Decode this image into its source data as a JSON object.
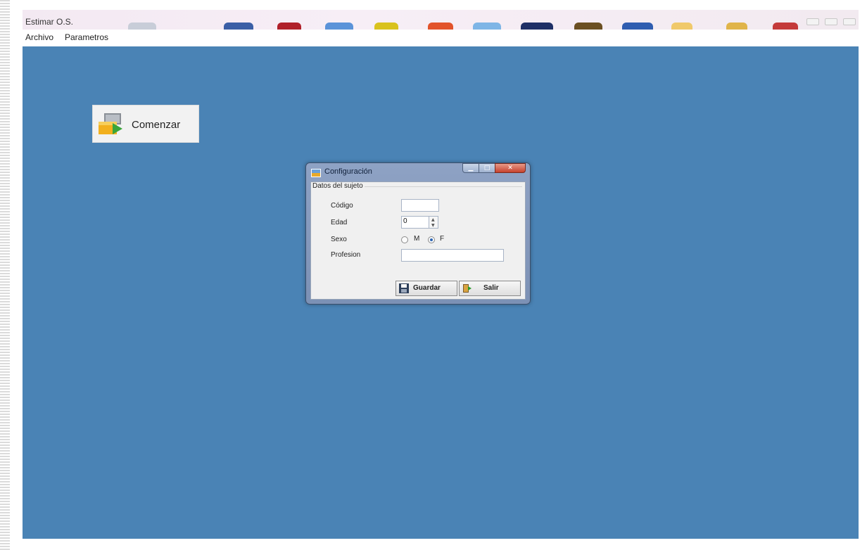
{
  "window": {
    "title": "Estimar O.S."
  },
  "menu": [
    {
      "label": "Archivo"
    },
    {
      "label": "Parametros"
    }
  ],
  "workspace": {
    "background": "#4a83b5"
  },
  "start_button": {
    "label": "Comenzar",
    "icon": "start-arrow-icon"
  },
  "dialog": {
    "title": "Configuración",
    "controls": [
      "minimize",
      "maximize",
      "close"
    ],
    "group_label": "Datos del sujeto",
    "fields": {
      "codigo": {
        "label": "Código",
        "value": ""
      },
      "edad": {
        "label": "Edad",
        "value": "0"
      },
      "sexo": {
        "label": "Sexo",
        "options": [
          "M",
          "F"
        ],
        "selected": "F"
      },
      "profesion": {
        "label": "Profesion",
        "value": ""
      }
    },
    "buttons": {
      "save": {
        "label": "Guardar",
        "icon": "floppy-disk-icon"
      },
      "exit": {
        "label": "Salir",
        "icon": "exit-door-icon"
      }
    }
  }
}
